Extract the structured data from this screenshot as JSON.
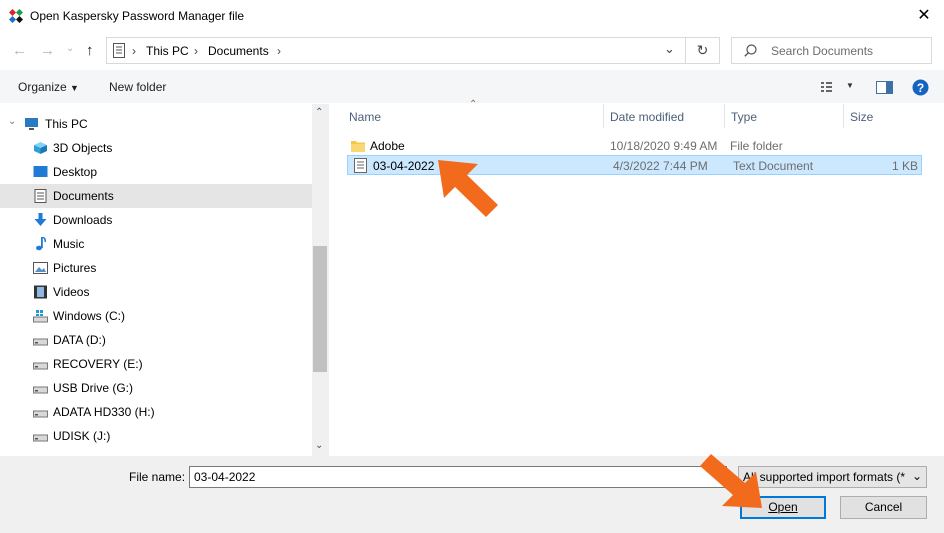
{
  "window": {
    "title": "Open Kaspersky Password Manager file"
  },
  "nav": {
    "breadcrumb": [
      "This PC",
      "Documents"
    ],
    "search_placeholder": "Search Documents"
  },
  "toolbar": {
    "organize_label": "Organize",
    "new_folder_label": "New folder"
  },
  "sidebar": {
    "items": [
      {
        "label": "This PC",
        "icon": "computer-icon"
      },
      {
        "label": "3D Objects",
        "icon": "cube-icon"
      },
      {
        "label": "Desktop",
        "icon": "desktop-icon"
      },
      {
        "label": "Documents",
        "icon": "document-folder-icon",
        "selected": true
      },
      {
        "label": "Downloads",
        "icon": "download-icon"
      },
      {
        "label": "Music",
        "icon": "music-icon"
      },
      {
        "label": "Pictures",
        "icon": "pictures-icon"
      },
      {
        "label": "Videos",
        "icon": "videos-icon"
      },
      {
        "label": "Windows (C:)",
        "icon": "windows-drive-icon"
      },
      {
        "label": "DATA (D:)",
        "icon": "drive-icon"
      },
      {
        "label": "RECOVERY (E:)",
        "icon": "drive-icon"
      },
      {
        "label": "USB Drive (G:)",
        "icon": "drive-icon"
      },
      {
        "label": "ADATA HD330 (H:)",
        "icon": "drive-icon"
      },
      {
        "label": "UDISK (J:)",
        "icon": "drive-icon"
      }
    ]
  },
  "files": {
    "columns": [
      "Name",
      "Date modified",
      "Type",
      "Size"
    ],
    "rows": [
      {
        "name": "Adobe",
        "date": "10/18/2020 9:49 AM",
        "type": "File folder",
        "size": "",
        "icon": "folder-icon"
      },
      {
        "name": "03-04-2022",
        "date": "4/3/2022 7:44 PM",
        "type": "Text Document",
        "size": "1 KB",
        "icon": "text-file-icon",
        "selected": true
      }
    ]
  },
  "footer": {
    "file_name_label": "File name:",
    "file_name_value": "03-04-2022",
    "filter_value": "All supported import formats (*",
    "open_label": "Open",
    "cancel_label": "Cancel"
  },
  "colors": {
    "accent": "#0078d7",
    "selection": "#cce8ff",
    "annotation_arrow": "#f26b1d"
  }
}
